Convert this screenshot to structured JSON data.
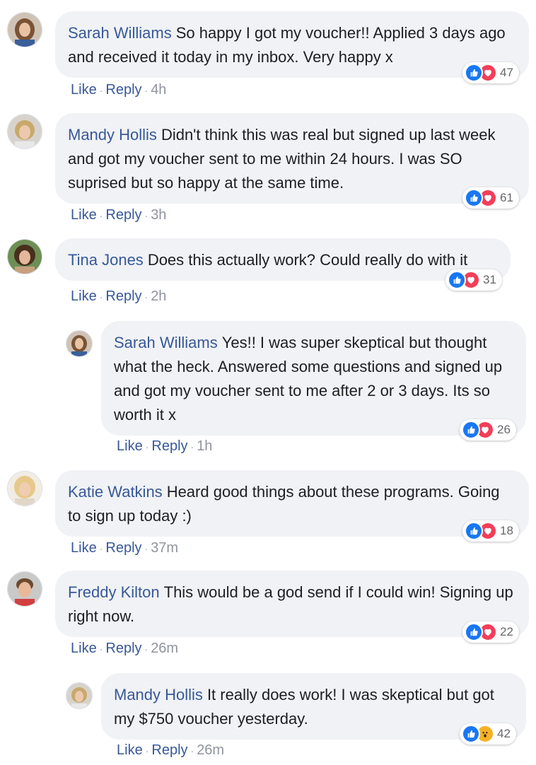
{
  "comments": [
    {
      "author": "Sarah Williams",
      "text": "So happy I got my voucher!! Applied 3 days ago and received it today in my inbox. Very happy x",
      "reaction_count": "47",
      "like_label": "Like",
      "reply_label": "Reply",
      "time": "4h"
    },
    {
      "author": "Mandy Hollis",
      "text": "Didn't think this was real but signed up last week and got my voucher sent to me within 24 hours. I was SO suprised but so happy at the same time.",
      "reaction_count": "61",
      "like_label": "Like",
      "reply_label": "Reply",
      "time": "3h"
    },
    {
      "author": "Tina Jones",
      "text": "Does this actually work? Could really do with it",
      "reaction_count": "31",
      "like_label": "Like",
      "reply_label": "Reply",
      "time": "2h"
    },
    {
      "author": "Sarah Williams",
      "text": "Yes!! I was super skeptical but thought what the heck. Answered some questions and signed up and got my voucher sent to me after 2 or 3 days. Its so worth it x",
      "reaction_count": "26",
      "like_label": "Like",
      "reply_label": "Reply",
      "time": "1h"
    },
    {
      "author": "Katie Watkins",
      "text": "Heard good things about these programs. Going to sign up today :)",
      "reaction_count": "18",
      "like_label": "Like",
      "reply_label": "Reply",
      "time": "37m"
    },
    {
      "author": "Freddy Kilton",
      "text": "This would be a god send if I could win! Signing up right now.",
      "reaction_count": "22",
      "like_label": "Like",
      "reply_label": "Reply",
      "time": "26m"
    },
    {
      "author": "Mandy Hollis",
      "text": "It really does work! I was skeptical but got my $750 voucher yesterday.",
      "reaction_count": "42",
      "like_label": "Like",
      "reply_label": "Reply",
      "time": "26m"
    }
  ],
  "reaction_types": [
    [
      "like-icon",
      "love-icon"
    ],
    [
      "like-icon",
      "love-icon"
    ],
    [
      "like-icon",
      "love-icon"
    ],
    [
      "like-icon",
      "love-icon"
    ],
    [
      "like-icon",
      "love-icon"
    ],
    [
      "like-icon",
      "love-icon"
    ],
    [
      "like-icon",
      "wow-icon"
    ]
  ],
  "colors": {
    "author_link": "#385898",
    "bubble_bg": "#f0f2f5",
    "like_blue": "#1877f2",
    "love_red": "#f33e58",
    "wow_yellow": "#f7b125",
    "meta_gray": "#90949c"
  }
}
